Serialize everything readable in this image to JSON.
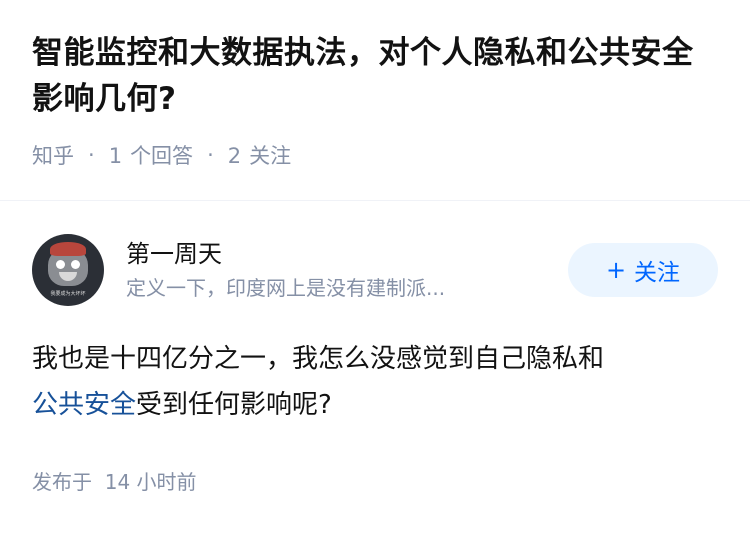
{
  "question": {
    "title": "智能监控和大数据执法，对个人隐私和公共安全影响几何?",
    "source": "知乎",
    "answer_count": "1",
    "answer_label": "个回答",
    "follow_count": "2",
    "follow_label": "关注",
    "separator": "·"
  },
  "answer": {
    "author_name": "第一周天",
    "author_bio": "定义一下，印度网上是没有建制派...",
    "avatar_text": "我要成为大坏坏",
    "follow_button": "关注",
    "follow_icon": "plus-icon",
    "body_before": "我也是十四亿分之一，我怎么没感觉到自己隐私和",
    "body_link": "公共安全",
    "body_after": "受到任何影响呢?",
    "time_prefix": "发布于",
    "time_value": "14 小时前"
  },
  "colors": {
    "link": "#175199",
    "accent": "#0066ff",
    "button_bg": "#ebf5ff",
    "meta": "#8590a6"
  }
}
